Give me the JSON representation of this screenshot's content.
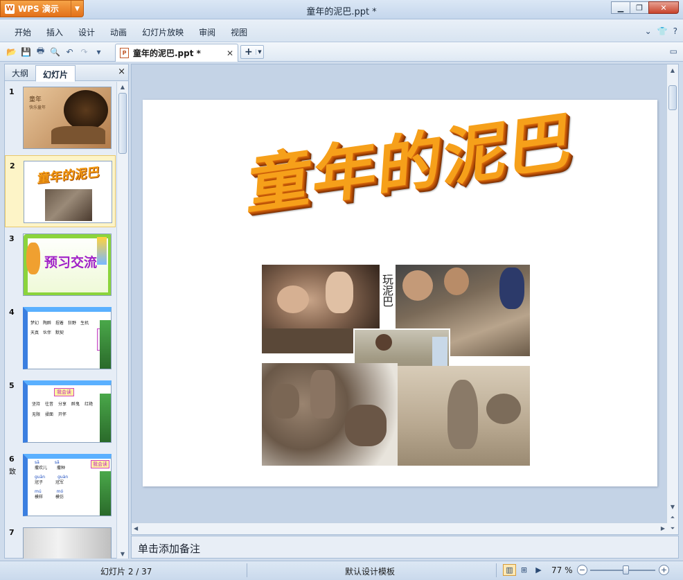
{
  "window": {
    "app_button_label": "WPS 演示",
    "app_logo": "W",
    "title": "童年的泥巴.ppt *",
    "controls": [
      "minimize-icon",
      "restore-icon",
      "close-icon"
    ]
  },
  "menu": {
    "items": [
      "开始",
      "插入",
      "设计",
      "动画",
      "幻灯片放映",
      "审阅",
      "视图"
    ],
    "right_icons": [
      "chevron-down-icon",
      "skin-icon",
      "help-icon"
    ]
  },
  "toolbar": {
    "icons": [
      "open-icon",
      "save-icon",
      "print-icon",
      "print-preview-icon",
      "undo-icon",
      "redo-icon",
      "customize-icon"
    ],
    "doc_tab_label": "童年的泥巴.ppt *",
    "new_tab_symbol": "+"
  },
  "left_panel": {
    "tab_outline": "大纲",
    "tab_slides": "幻灯片",
    "close_symbol": "×",
    "thumbs": [
      {
        "num": "1",
        "title": "童年"
      },
      {
        "num": "2",
        "title": "童年的泥巴"
      },
      {
        "num": "3",
        "title": "预习交流"
      },
      {
        "num": "4",
        "title": "我会读"
      },
      {
        "num": "5",
        "title": "我会读"
      },
      {
        "num": "6",
        "title": "我会读"
      },
      {
        "num": "7",
        "title": ""
      }
    ],
    "thumb6_side_char": "致",
    "thumb1_lines": [
      "快乐童年"
    ],
    "thumb4_words": [
      "梦幻",
      "陶醉",
      "捏着",
      "狂野",
      "生机",
      "天真",
      "伙伴",
      "默契"
    ],
    "thumb5_words": [
      "坚持",
      "往昔",
      "分享",
      "醉鬼",
      "红艳",
      "无限",
      "揉面",
      "开怀"
    ],
    "thumb6_rows": [
      {
        "py1": "sā",
        "w1": "撒欢儿",
        "py2": "sǎ",
        "w2": "撒种"
      },
      {
        "py1": "guān",
        "w1": "冠子",
        "py2": "guàn",
        "w2": "冠军"
      },
      {
        "py1": "mú",
        "w1": "模样",
        "py2": "mó",
        "w2": "模仿"
      }
    ]
  },
  "slide": {
    "title": "童年的泥巴",
    "photo_label": "玩泥巴"
  },
  "notes": {
    "placeholder": "单击添加备注"
  },
  "status": {
    "slide_indicator": "幻灯片 2 / 37",
    "template": "默认设计模板",
    "zoom": "77 %",
    "zoom_fraction": 0.55,
    "view_icons": [
      "normal-view-icon",
      "sorter-view-icon",
      "slideshow-view-icon"
    ]
  }
}
